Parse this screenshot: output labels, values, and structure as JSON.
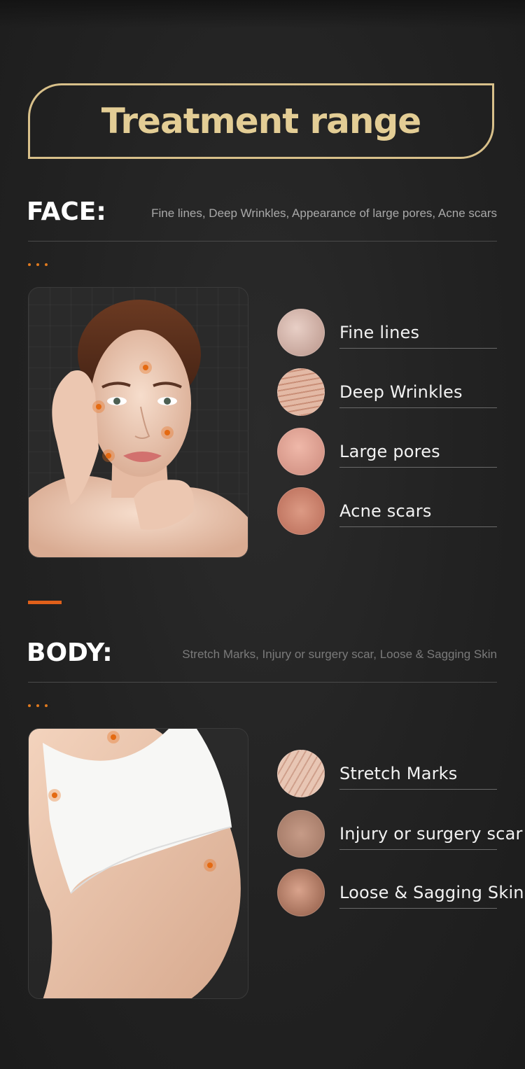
{
  "title": "Treatment range",
  "face": {
    "heading": "FACE:",
    "description": "Fine lines, Deep Wrinkles, Appearance of large pores, Acne scars",
    "conditions": [
      {
        "label": "Fine lines",
        "icon": "fine-lines-thumb"
      },
      {
        "label": "Deep Wrinkles",
        "icon": "deep-wrinkles-thumb"
      },
      {
        "label": "Large pores",
        "icon": "large-pores-thumb"
      },
      {
        "label": "Acne scars",
        "icon": "acne-scars-thumb"
      }
    ]
  },
  "body": {
    "heading": "BODY:",
    "description": "Stretch Marks, Injury or surgery scar, Loose & Sagging Skin",
    "conditions": [
      {
        "label": "Stretch Marks",
        "icon": "stretch-marks-thumb"
      },
      {
        "label": "Injury or surgery scar",
        "icon": "surgery-scar-thumb"
      },
      {
        "label": "Loose & Sagging Skin",
        "icon": "sagging-skin-thumb"
      }
    ]
  },
  "colors": {
    "gold": "#d8c08a",
    "accent": "#e46a12",
    "background": "#242424"
  }
}
